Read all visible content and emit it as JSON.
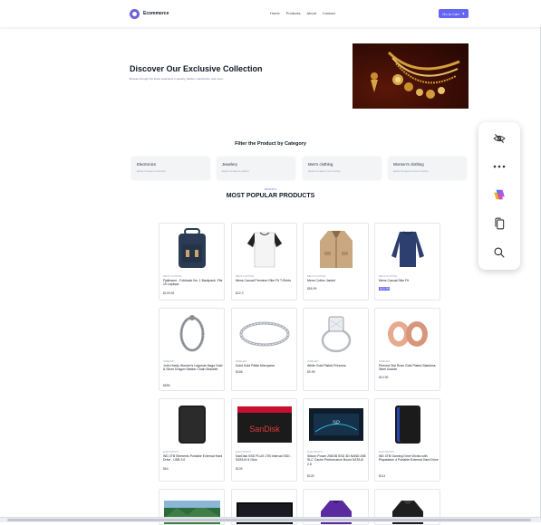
{
  "navbar": {
    "brand": "Ecommerce",
    "links": [
      "Home",
      "Products",
      "About",
      "Contact"
    ],
    "cart_label": "Go to Cart"
  },
  "hero": {
    "title": "Discover Our Exclusive Collection",
    "subtitle": "Browse through the finest selections in jewelry, fashion, electronics, and more."
  },
  "filter": {
    "title": "Filter the Product by Category",
    "categories": [
      {
        "name": "Electronics",
        "desc": "Explore the latest in electronics"
      },
      {
        "name": "Jewelery",
        "desc": "Explore the latest in jewellery"
      },
      {
        "name": "Men's clothing",
        "desc": "Explore the latest in men's clothing"
      },
      {
        "name": "Women's clothing",
        "desc": "Explore the latest in women's clothing"
      }
    ]
  },
  "popular": {
    "kicker": "PRODUCTS",
    "title": "MOST POPULAR PRODUCTS"
  },
  "products": [
    {
      "category": "men's clothing",
      "title": "Fjallraven - Foldsack No. 1 Backpack, Fits 15 Laptops",
      "price": "$109.95"
    },
    {
      "category": "men's clothing",
      "title": "Mens Casual Premium Slim Fit T-Shirts",
      "price": "$22.3"
    },
    {
      "category": "men's clothing",
      "title": "Mens Cotton Jacket",
      "price": "$55.99"
    },
    {
      "category": "men's clothing",
      "title": "Mens Casual Slim Fit",
      "price": "$15.99"
    },
    {
      "category": "jewelery",
      "title": "John Hardy Women's Legends Naga Gold & Silver Dragon Station Chain Bracelet",
      "price": "$695"
    },
    {
      "category": "jewelery",
      "title": "Solid Gold Petite Micropave",
      "price": "$168"
    },
    {
      "category": "jewelery",
      "title": "White Gold Plated Princess",
      "price": "$9.99"
    },
    {
      "category": "jewelery",
      "title": "Pierced Owl Rose Gold Plated Stainless Steel Double",
      "price": "$10.99"
    },
    {
      "category": "electronics",
      "title": "WD 2TB Elements Portable External Hard Drive - USB 3.0",
      "price": "$64"
    },
    {
      "category": "electronics",
      "title": "SanDisk SSD PLUS 1TB Internal SSD - SATA III 6 Gb/s",
      "price": "$109"
    },
    {
      "category": "electronics",
      "title": "Silicon Power 256GB SSD 3D NAND A55 SLC Cache Performance Boost SATA III 2.5",
      "price": "$109"
    },
    {
      "category": "electronics",
      "title": "WD 4TB Gaming Drive Works with Playstation 4 Portable External Hard Drive",
      "price": "$114"
    }
  ],
  "floating_toolbar": {
    "icons": [
      "eye-off-icon",
      "more-icon",
      "copilot-icon",
      "copy-icon",
      "search-icon"
    ]
  }
}
